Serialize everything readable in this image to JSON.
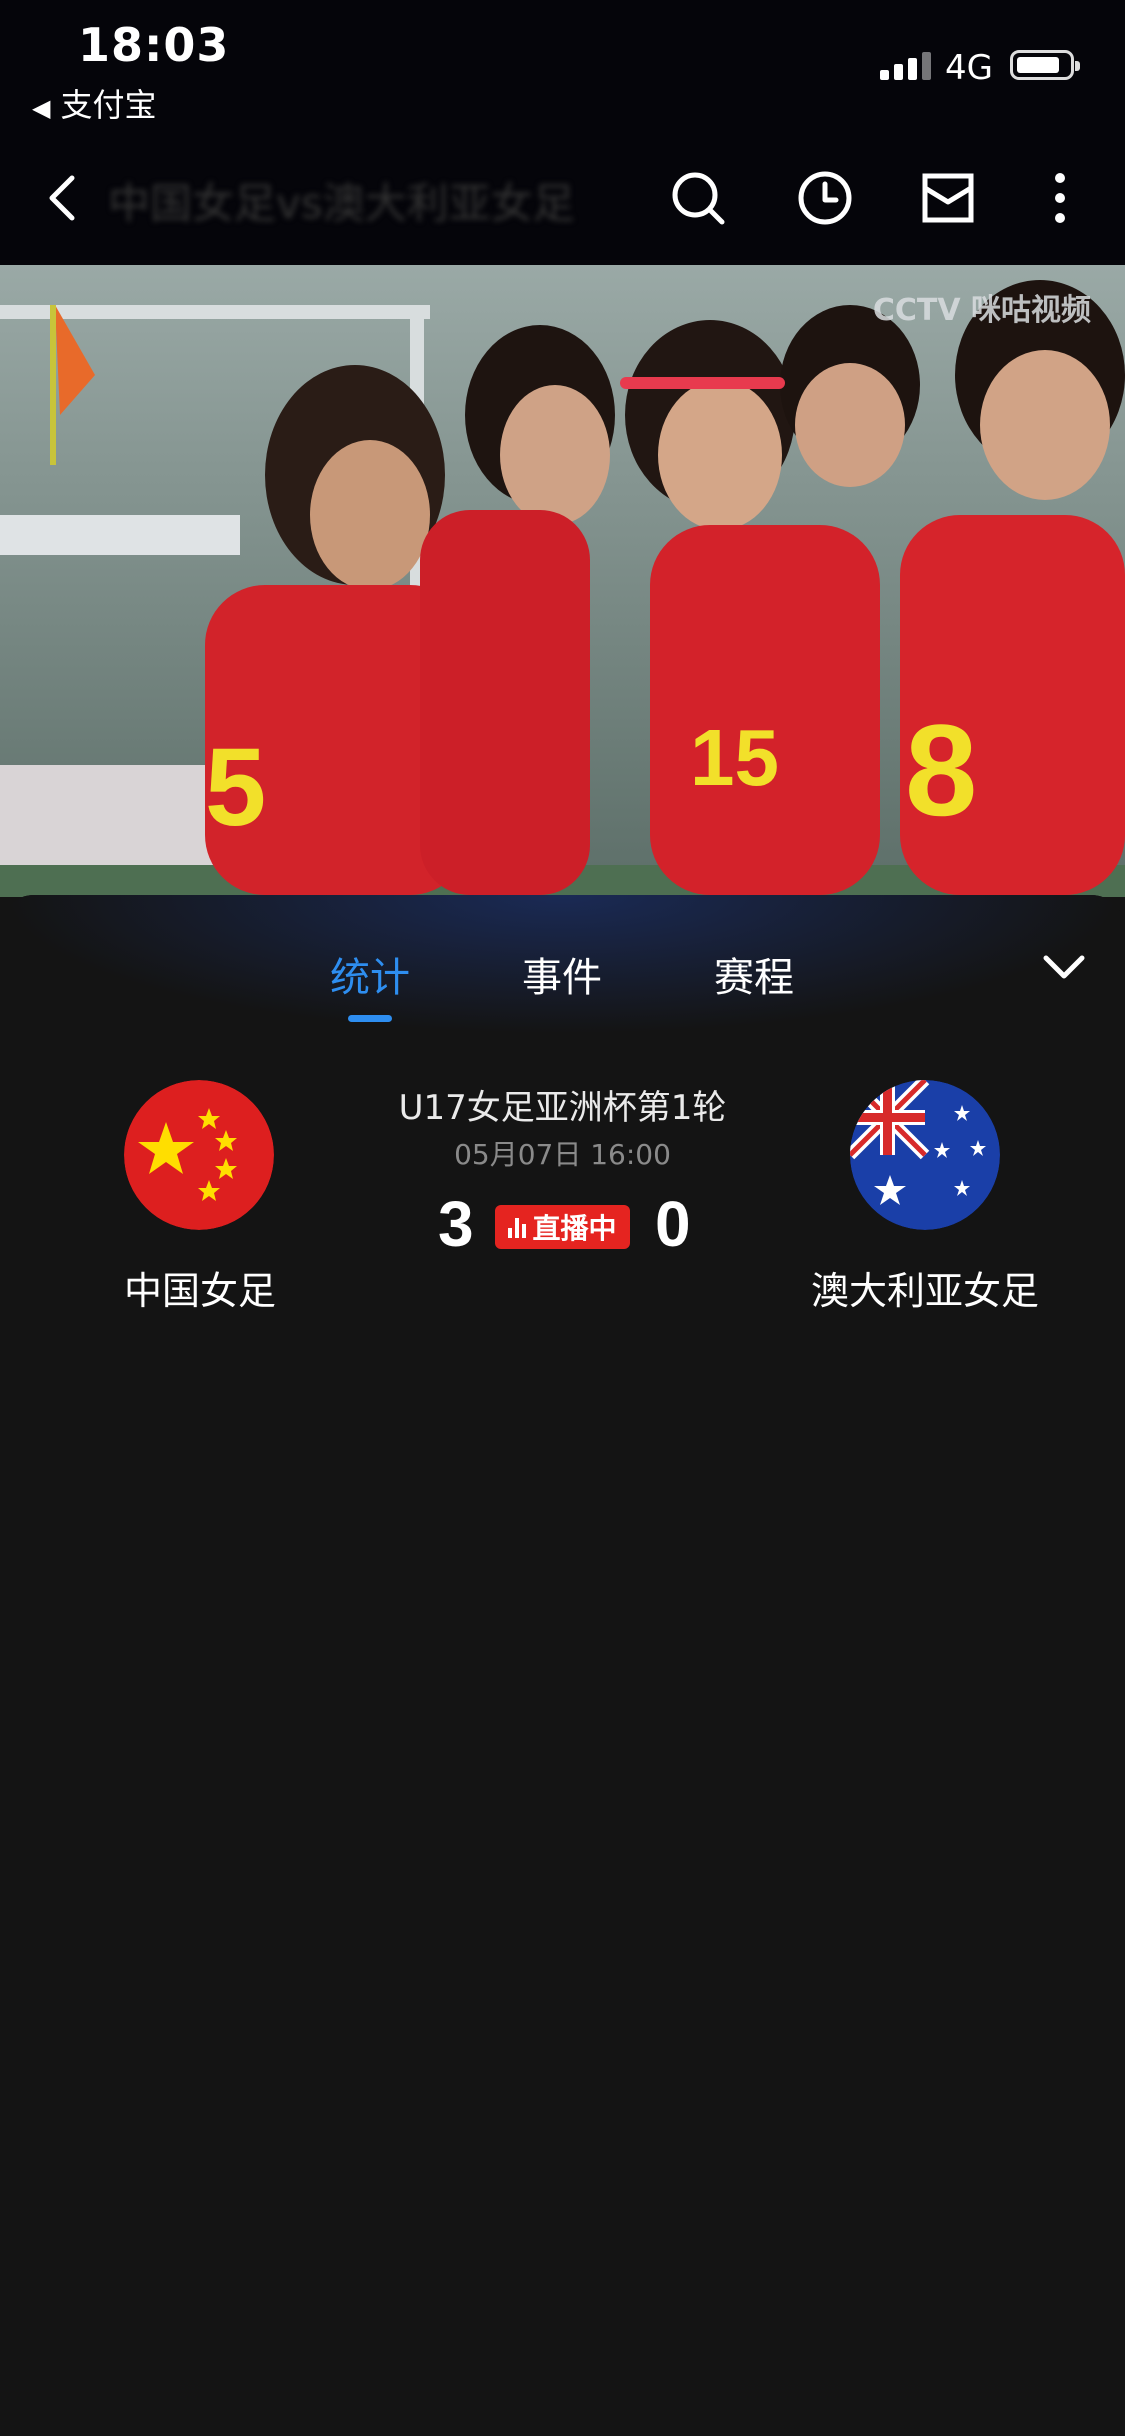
{
  "status_bar": {
    "time": "18:03",
    "back_app": "支付宝",
    "network": "4G"
  },
  "nav": {
    "title": "中国女足vs澳大利亚女足",
    "icons": [
      "back-icon",
      "search-icon",
      "history-icon",
      "inbox-icon",
      "more-icon"
    ]
  },
  "video": {
    "watermark": "CCTV 咪咕视频"
  },
  "tabs": [
    {
      "label": "统计",
      "active": true
    },
    {
      "label": "事件",
      "active": false
    },
    {
      "label": "赛程",
      "active": false
    }
  ],
  "match": {
    "title": "U17女足亚洲杯第1轮",
    "date": "05月07日 16:00",
    "home": {
      "name": "中国女足",
      "score": "3"
    },
    "away": {
      "name": "澳大利亚女足",
      "score": "0"
    },
    "live_label": "直播中"
  },
  "colors": {
    "accent": "#2e8ef0",
    "live": "#e52420",
    "background": "#141414"
  }
}
